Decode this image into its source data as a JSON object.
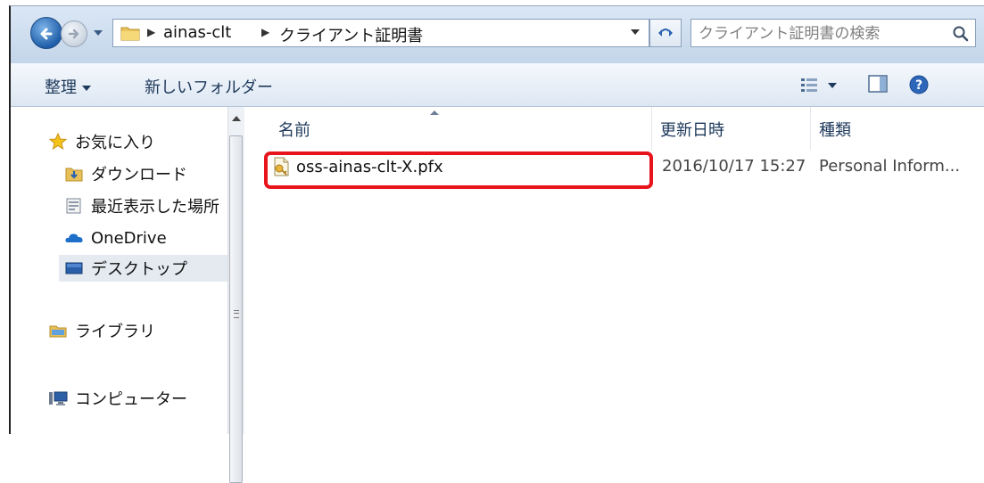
{
  "breadcrumb": {
    "items": [
      "ainas-clt",
      "クライアント証明書"
    ]
  },
  "search": {
    "placeholder": "クライアント証明書の検索"
  },
  "toolbar": {
    "organize_label": "整理",
    "new_folder_label": "新しいフォルダー"
  },
  "nav_pane": {
    "items": [
      {
        "label": "お気に入り",
        "icon": "star-icon"
      },
      {
        "label": "ダウンロード",
        "icon": "downloads-folder-icon"
      },
      {
        "label": "最近表示した場所",
        "icon": "recent-places-icon"
      },
      {
        "label": "OneDrive",
        "icon": "onedrive-cloud-icon"
      },
      {
        "label": "デスクトップ",
        "icon": "desktop-icon",
        "selected": true
      },
      {
        "label": "ライブラリ",
        "icon": "libraries-icon"
      },
      {
        "label": "コンピューター",
        "icon": "computer-icon"
      }
    ]
  },
  "file_list": {
    "columns": [
      "名前",
      "更新日時",
      "種類"
    ],
    "rows": [
      {
        "name": "oss-ainas-clt-X.pfx",
        "modified": "2016/10/17 15:27",
        "type": "Personal Inform...",
        "icon": "certificate-file-icon",
        "highlighted": true
      }
    ]
  },
  "colors": {
    "highlight": "#e8141c",
    "toolbar_text": "#1e395b",
    "selection_bg": "#e5eaf1"
  }
}
